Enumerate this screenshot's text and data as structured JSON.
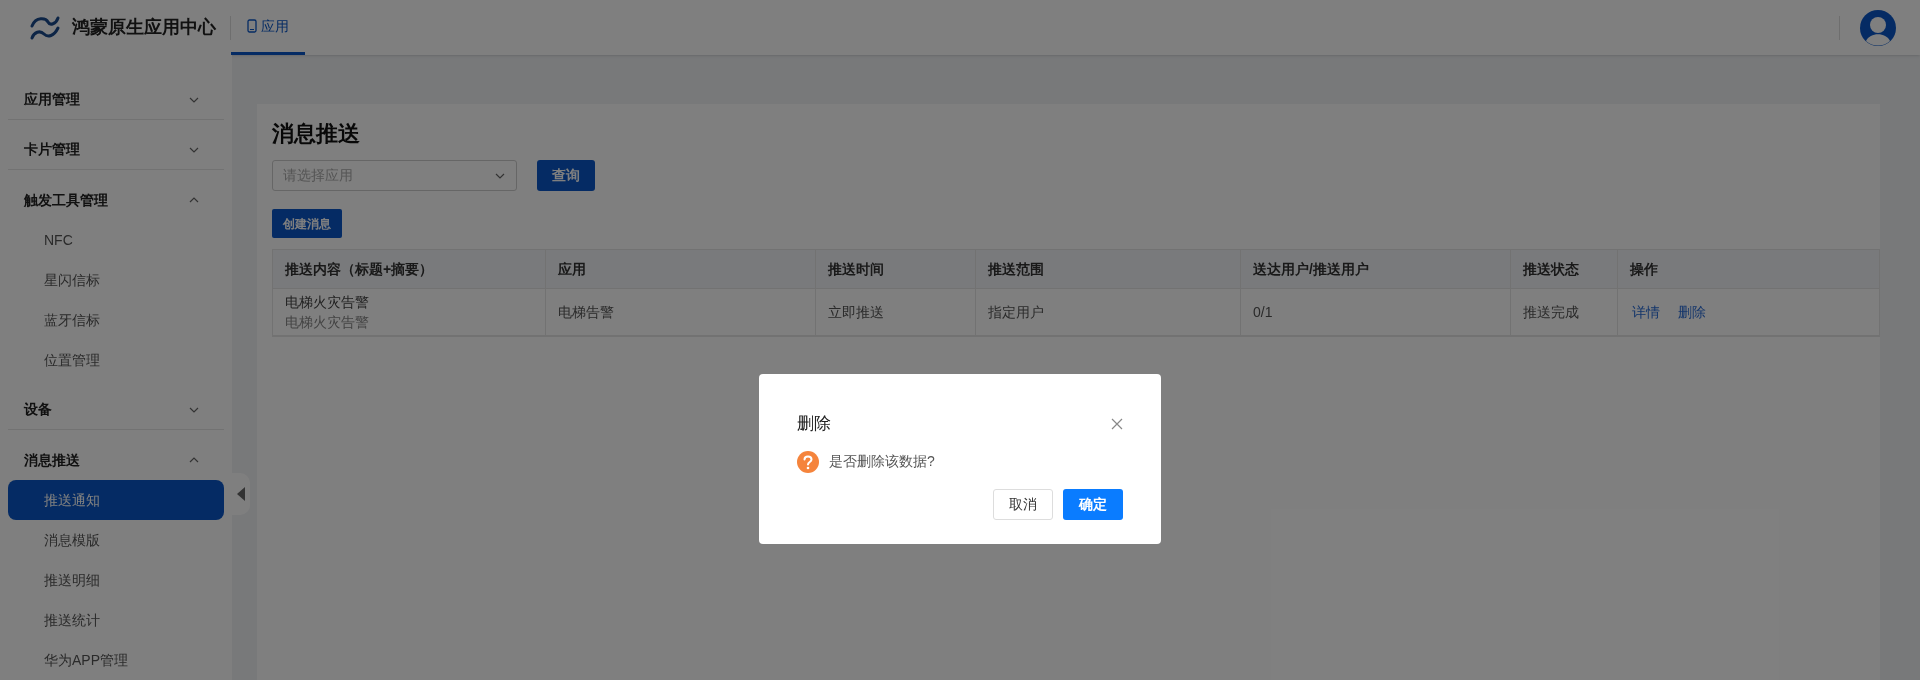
{
  "header": {
    "logo_text": "鸿蒙原生应用中心",
    "nav_tabs": [
      {
        "label": "应用",
        "selected": true
      }
    ]
  },
  "sidebar": {
    "groups": [
      {
        "label": "应用管理",
        "expanded": false
      },
      {
        "label": "卡片管理",
        "expanded": false
      },
      {
        "label": "触发工具管理",
        "expanded": true,
        "children": [
          {
            "label": "NFC",
            "selected": false
          },
          {
            "label": "星闪信标",
            "selected": false
          },
          {
            "label": "蓝牙信标",
            "selected": false
          },
          {
            "label": "位置管理",
            "selected": false
          }
        ]
      },
      {
        "label": "设备",
        "expanded": false
      },
      {
        "label": "消息推送",
        "expanded": true,
        "children": [
          {
            "label": "推送通知",
            "selected": true
          },
          {
            "label": "消息模版",
            "selected": false
          },
          {
            "label": "推送明细",
            "selected": false
          },
          {
            "label": "推送统计",
            "selected": false
          },
          {
            "label": "华为APP管理",
            "selected": false
          }
        ]
      }
    ]
  },
  "page": {
    "title": "消息推送",
    "filter": {
      "placeholder": "请选择应用"
    },
    "query_button": "查询",
    "create_button": "创建消息",
    "table": {
      "columns": [
        "推送内容（标题+摘要）",
        "应用",
        "推送时间",
        "推送范围",
        "送达用户/推送用户",
        "推送状态",
        "操作"
      ],
      "rows": [
        {
          "title": "电梯火灾告警",
          "summary": "电梯火灾告警",
          "app": "电梯告警",
          "time": "立即推送",
          "scope": "指定用户",
          "delivered": "0/1",
          "status": "推送完成",
          "actions": [
            "详情",
            "删除"
          ]
        }
      ]
    }
  },
  "dialog": {
    "title": "删除",
    "message": "是否删除该数据?",
    "buttons": [
      {
        "label": "取消",
        "kind": "default"
      },
      {
        "label": "确定",
        "kind": "primary"
      }
    ]
  }
}
